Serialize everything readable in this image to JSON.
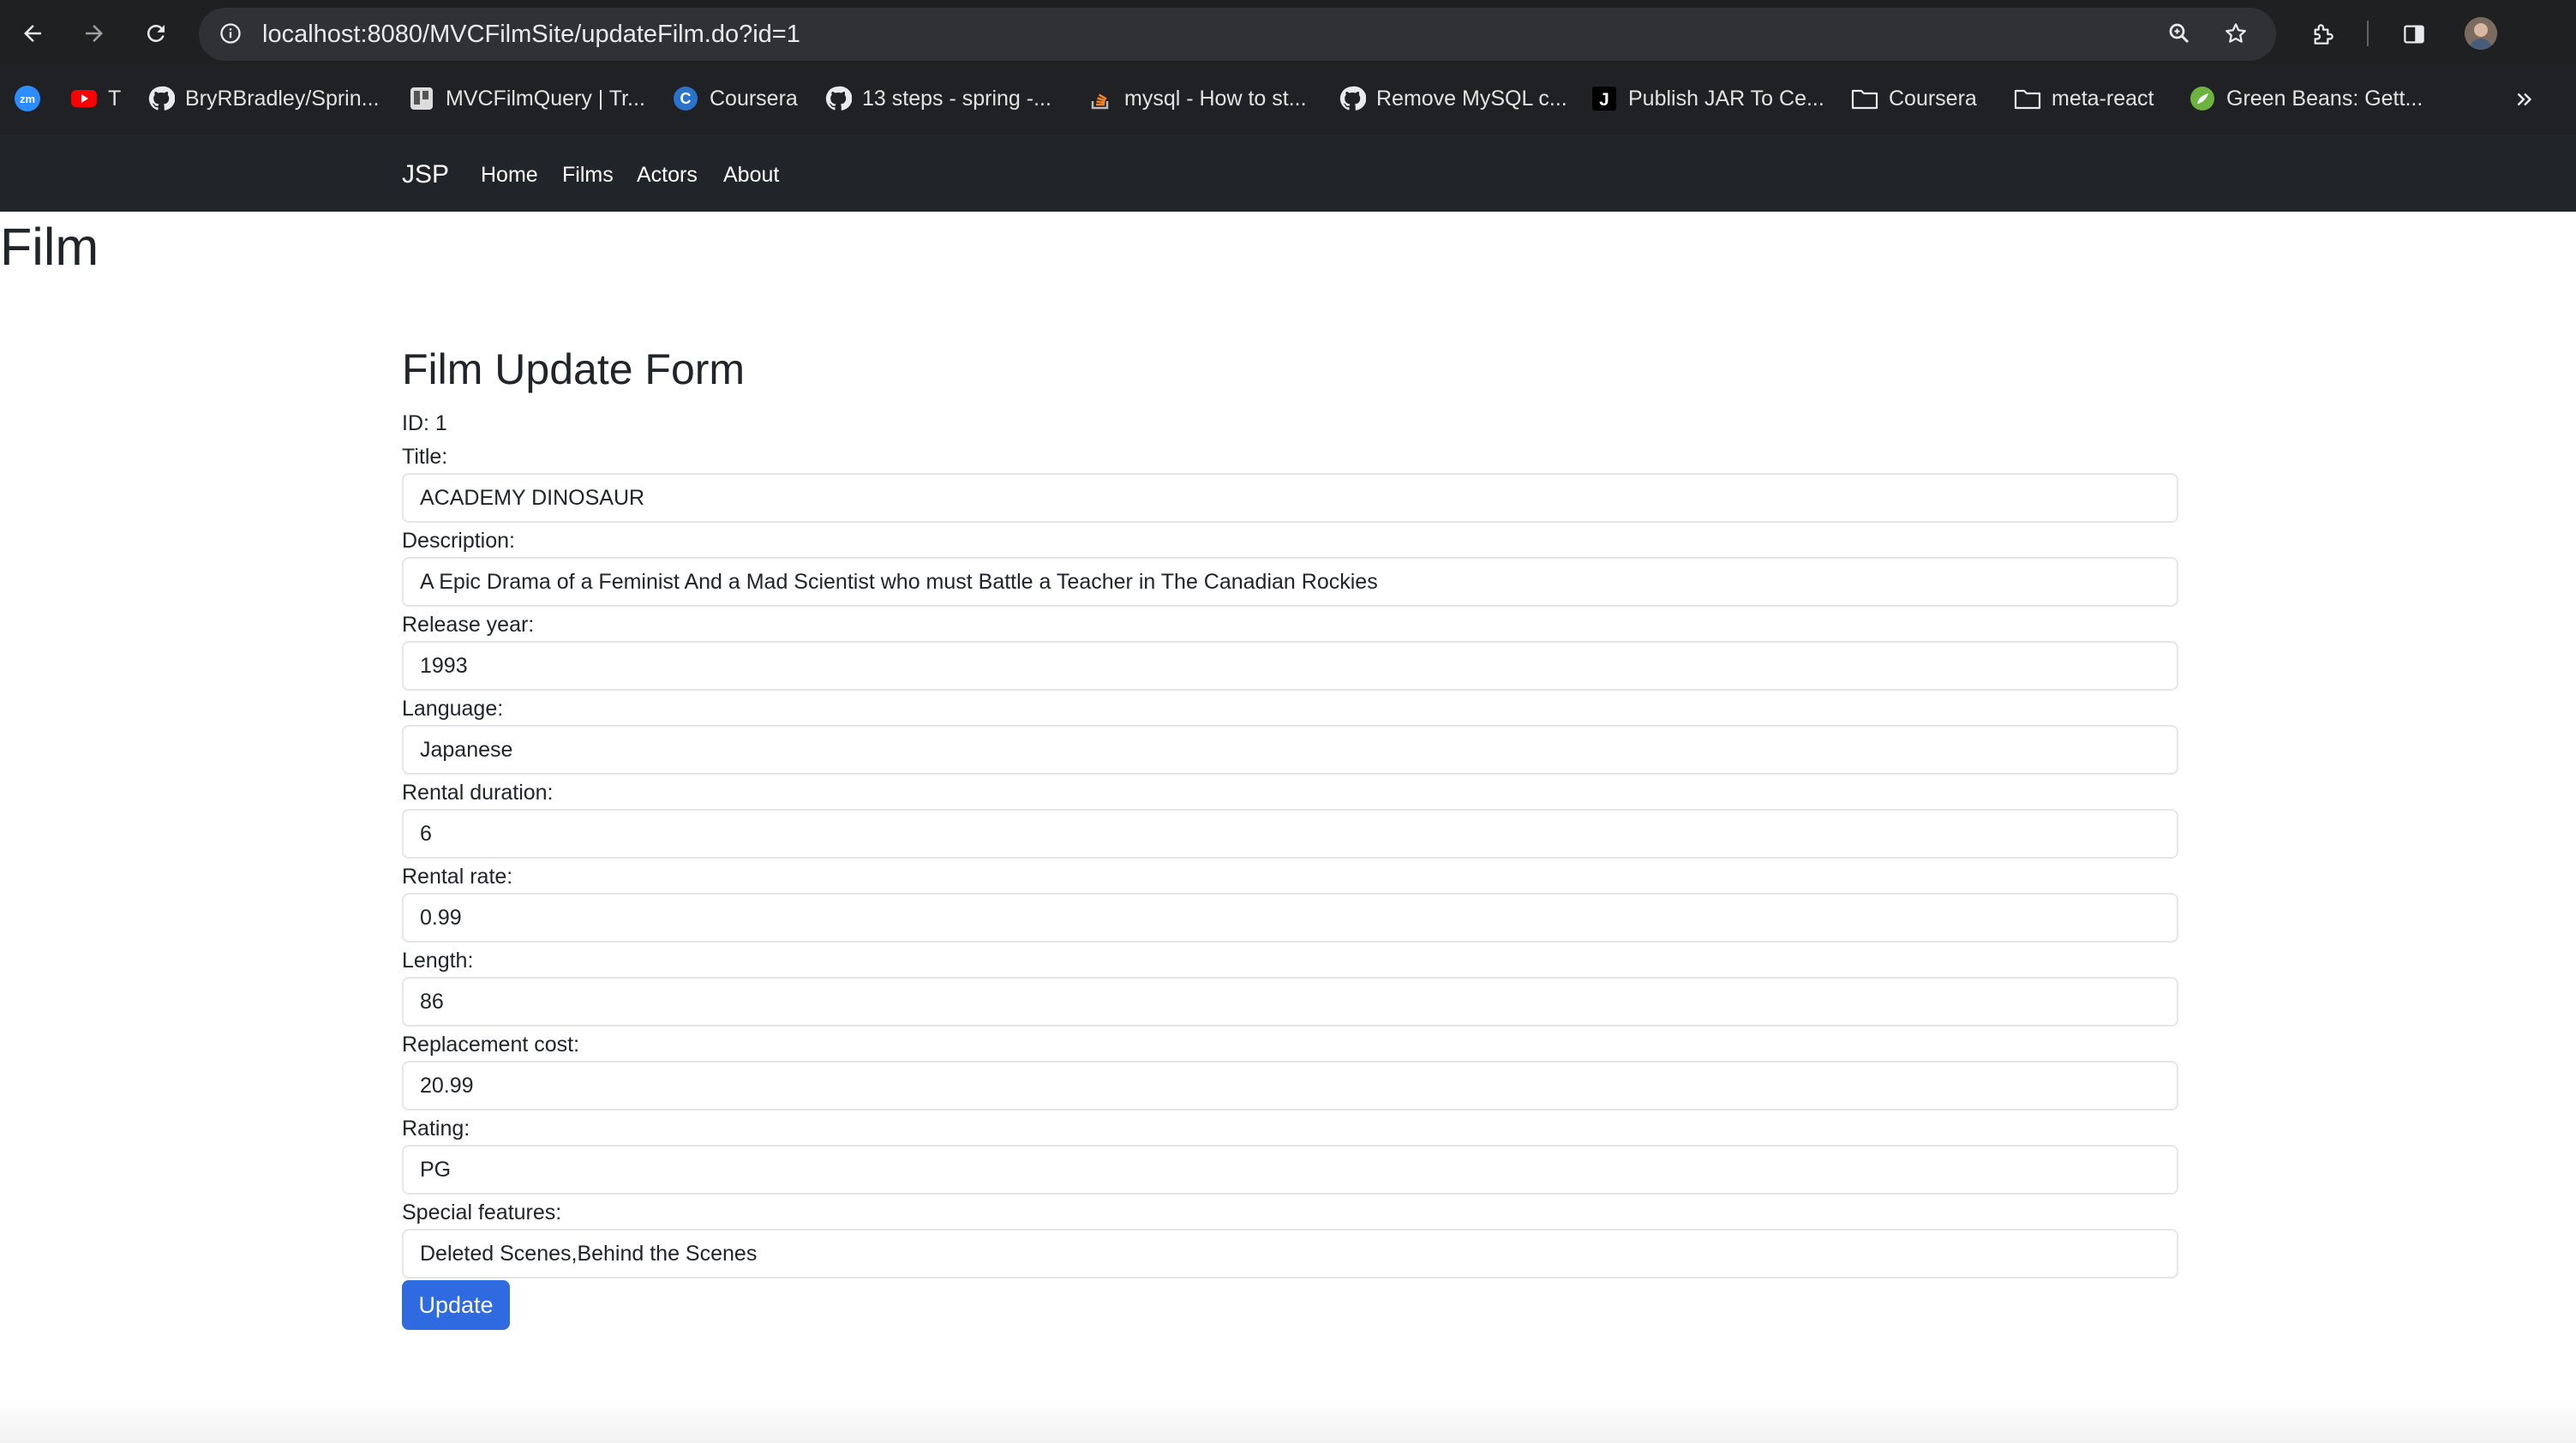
{
  "browser": {
    "url": "localhost:8080/MVCFilmSite/updateFilm.do?id=1",
    "bookmarks": [
      {
        "label": "",
        "icon": "zoom-icon"
      },
      {
        "label": "T",
        "icon": "youtube-icon"
      },
      {
        "label": "BryRBradley/Sprin...",
        "icon": "github-icon"
      },
      {
        "label": "MVCFilmQuery | Tr...",
        "icon": "trello-icon"
      },
      {
        "label": "Coursera",
        "icon": "coursera-icon"
      },
      {
        "label": "13 steps - spring -...",
        "icon": "github-icon"
      },
      {
        "label": "mysql - How to st...",
        "icon": "stackoverflow-icon"
      },
      {
        "label": "Remove MySQL c...",
        "icon": "github-icon"
      },
      {
        "label": "Publish JAR To Ce...",
        "icon": "jfrog-icon"
      },
      {
        "label": "Coursera",
        "icon": "folder-icon"
      },
      {
        "label": "meta-react",
        "icon": "folder-icon"
      },
      {
        "label": "Green Beans: Gett...",
        "icon": "spring-icon"
      }
    ],
    "zoom_badge": "zm"
  },
  "navbar": {
    "brand": "JSP",
    "links": [
      "Home",
      "Films",
      "Actors",
      "About"
    ]
  },
  "page": {
    "title": "Film"
  },
  "form": {
    "title": "Film Update Form",
    "id_label": "ID: 1",
    "fields": [
      {
        "label": "Title:",
        "value": "ACADEMY DINOSAUR"
      },
      {
        "label": "Description:",
        "value": "A Epic Drama of a Feminist And a Mad Scientist who must Battle a Teacher in The Canadian Rockies"
      },
      {
        "label": "Release year:",
        "value": "1993"
      },
      {
        "label": "Language:",
        "value": "Japanese"
      },
      {
        "label": "Rental duration:",
        "value": "6"
      },
      {
        "label": "Rental rate:",
        "value": "0.99"
      },
      {
        "label": "Length:",
        "value": "86"
      },
      {
        "label": "Replacement cost:",
        "value": "20.99"
      },
      {
        "label": "Rating:",
        "value": "PG"
      },
      {
        "label": "Special features:",
        "value": "Deleted Scenes,Behind the Scenes"
      }
    ],
    "submit_label": "Update"
  },
  "colors": {
    "navbar_bg": "#212529",
    "button_bg": "#2f6ae0",
    "chrome_bg": "#1f2022"
  }
}
